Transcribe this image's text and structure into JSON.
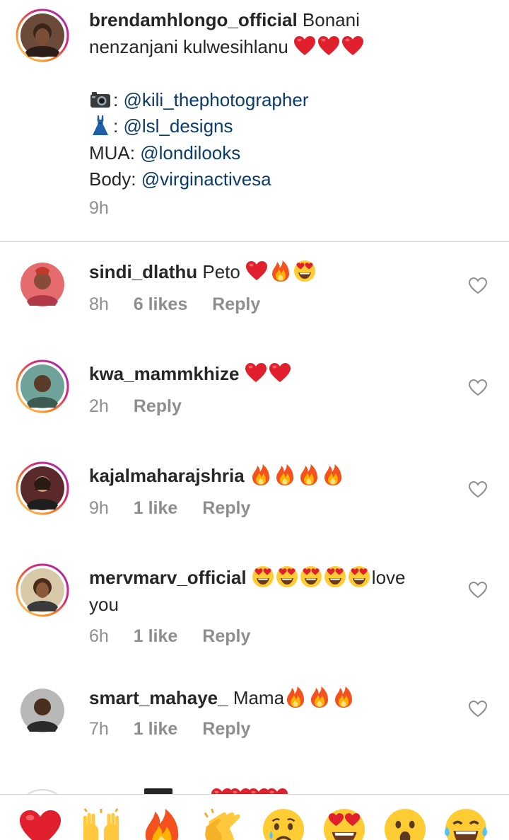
{
  "caption": {
    "username": "brendamhlongo_official",
    "text_line1": "Bonani",
    "text_line2": "nenzanjani kulwesihlanu",
    "credit_camera_sep": ":",
    "credit_camera_handle": "@kili_thephotographer",
    "credit_dress_sep": ":",
    "credit_dress_handle": "@lsl_designs",
    "credit_mua_label": "MUA:",
    "credit_mua_handle": "@londilooks",
    "credit_body_label": "Body:",
    "credit_body_handle": "@virginactivesa",
    "time": "9h",
    "emojis": [
      "red-heart",
      "red-heart",
      "red-heart"
    ]
  },
  "comments": [
    {
      "username": "sindi_dlathu",
      "text": "Peto",
      "emojis": [
        "red-heart",
        "fire",
        "heart-eyes"
      ],
      "time": "8h",
      "likes": "6 likes",
      "reply": "Reply"
    },
    {
      "username": "kwa_mammkhize",
      "text": "",
      "emojis": [
        "red-heart",
        "red-heart"
      ],
      "time": "2h",
      "likes": "",
      "reply": "Reply"
    },
    {
      "username": "kajalmaharajshria",
      "text": "",
      "emojis": [
        "fire",
        "fire",
        "fire",
        "fire"
      ],
      "time": "9h",
      "likes": "1 like",
      "reply": "Reply"
    },
    {
      "username": "mervmarv_official",
      "text": "love",
      "text2": "you",
      "emojis": [
        "heart-eyes",
        "heart-eyes",
        "heart-eyes",
        "heart-eyes",
        "heart-eyes"
      ],
      "time": "6h",
      "likes": "1 like",
      "reply": "Reply"
    },
    {
      "username": "smart_mahaye_",
      "text": "Mama",
      "emojis": [
        "fire",
        "fire",
        "fire"
      ],
      "time": "7h",
      "likes": "1 like",
      "reply": "Reply"
    }
  ],
  "reaction_bar": {
    "emojis": [
      "red-heart",
      "raising-hands",
      "fire",
      "clapping-hands",
      "crying-face",
      "heart-eyes",
      "open-mouth-face",
      "tears-of-joy"
    ]
  },
  "colors": {
    "text": "#262626",
    "meta": "#8e8e8e",
    "mention": "#0b3b6b",
    "divider": "#dbdbdb",
    "heart": "#e0202c",
    "story_ring": "#d62976"
  }
}
